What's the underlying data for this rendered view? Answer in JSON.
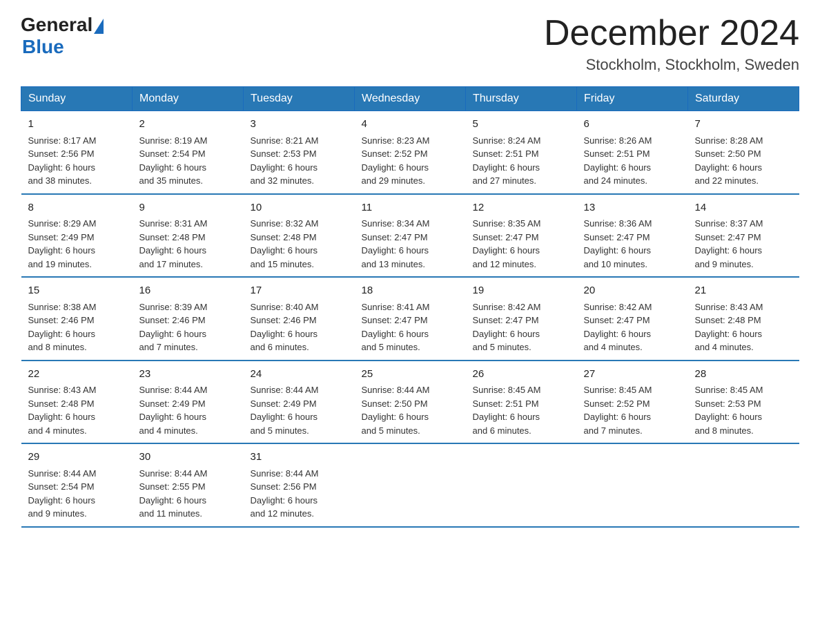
{
  "logo": {
    "general": "General",
    "blue": "Blue"
  },
  "header": {
    "month_year": "December 2024",
    "location": "Stockholm, Stockholm, Sweden"
  },
  "days_of_week": [
    "Sunday",
    "Monday",
    "Tuesday",
    "Wednesday",
    "Thursday",
    "Friday",
    "Saturday"
  ],
  "weeks": [
    [
      {
        "day": "1",
        "info": "Sunrise: 8:17 AM\nSunset: 2:56 PM\nDaylight: 6 hours\nand 38 minutes."
      },
      {
        "day": "2",
        "info": "Sunrise: 8:19 AM\nSunset: 2:54 PM\nDaylight: 6 hours\nand 35 minutes."
      },
      {
        "day": "3",
        "info": "Sunrise: 8:21 AM\nSunset: 2:53 PM\nDaylight: 6 hours\nand 32 minutes."
      },
      {
        "day": "4",
        "info": "Sunrise: 8:23 AM\nSunset: 2:52 PM\nDaylight: 6 hours\nand 29 minutes."
      },
      {
        "day": "5",
        "info": "Sunrise: 8:24 AM\nSunset: 2:51 PM\nDaylight: 6 hours\nand 27 minutes."
      },
      {
        "day": "6",
        "info": "Sunrise: 8:26 AM\nSunset: 2:51 PM\nDaylight: 6 hours\nand 24 minutes."
      },
      {
        "day": "7",
        "info": "Sunrise: 8:28 AM\nSunset: 2:50 PM\nDaylight: 6 hours\nand 22 minutes."
      }
    ],
    [
      {
        "day": "8",
        "info": "Sunrise: 8:29 AM\nSunset: 2:49 PM\nDaylight: 6 hours\nand 19 minutes."
      },
      {
        "day": "9",
        "info": "Sunrise: 8:31 AM\nSunset: 2:48 PM\nDaylight: 6 hours\nand 17 minutes."
      },
      {
        "day": "10",
        "info": "Sunrise: 8:32 AM\nSunset: 2:48 PM\nDaylight: 6 hours\nand 15 minutes."
      },
      {
        "day": "11",
        "info": "Sunrise: 8:34 AM\nSunset: 2:47 PM\nDaylight: 6 hours\nand 13 minutes."
      },
      {
        "day": "12",
        "info": "Sunrise: 8:35 AM\nSunset: 2:47 PM\nDaylight: 6 hours\nand 12 minutes."
      },
      {
        "day": "13",
        "info": "Sunrise: 8:36 AM\nSunset: 2:47 PM\nDaylight: 6 hours\nand 10 minutes."
      },
      {
        "day": "14",
        "info": "Sunrise: 8:37 AM\nSunset: 2:47 PM\nDaylight: 6 hours\nand 9 minutes."
      }
    ],
    [
      {
        "day": "15",
        "info": "Sunrise: 8:38 AM\nSunset: 2:46 PM\nDaylight: 6 hours\nand 8 minutes."
      },
      {
        "day": "16",
        "info": "Sunrise: 8:39 AM\nSunset: 2:46 PM\nDaylight: 6 hours\nand 7 minutes."
      },
      {
        "day": "17",
        "info": "Sunrise: 8:40 AM\nSunset: 2:46 PM\nDaylight: 6 hours\nand 6 minutes."
      },
      {
        "day": "18",
        "info": "Sunrise: 8:41 AM\nSunset: 2:47 PM\nDaylight: 6 hours\nand 5 minutes."
      },
      {
        "day": "19",
        "info": "Sunrise: 8:42 AM\nSunset: 2:47 PM\nDaylight: 6 hours\nand 5 minutes."
      },
      {
        "day": "20",
        "info": "Sunrise: 8:42 AM\nSunset: 2:47 PM\nDaylight: 6 hours\nand 4 minutes."
      },
      {
        "day": "21",
        "info": "Sunrise: 8:43 AM\nSunset: 2:48 PM\nDaylight: 6 hours\nand 4 minutes."
      }
    ],
    [
      {
        "day": "22",
        "info": "Sunrise: 8:43 AM\nSunset: 2:48 PM\nDaylight: 6 hours\nand 4 minutes."
      },
      {
        "day": "23",
        "info": "Sunrise: 8:44 AM\nSunset: 2:49 PM\nDaylight: 6 hours\nand 4 minutes."
      },
      {
        "day": "24",
        "info": "Sunrise: 8:44 AM\nSunset: 2:49 PM\nDaylight: 6 hours\nand 5 minutes."
      },
      {
        "day": "25",
        "info": "Sunrise: 8:44 AM\nSunset: 2:50 PM\nDaylight: 6 hours\nand 5 minutes."
      },
      {
        "day": "26",
        "info": "Sunrise: 8:45 AM\nSunset: 2:51 PM\nDaylight: 6 hours\nand 6 minutes."
      },
      {
        "day": "27",
        "info": "Sunrise: 8:45 AM\nSunset: 2:52 PM\nDaylight: 6 hours\nand 7 minutes."
      },
      {
        "day": "28",
        "info": "Sunrise: 8:45 AM\nSunset: 2:53 PM\nDaylight: 6 hours\nand 8 minutes."
      }
    ],
    [
      {
        "day": "29",
        "info": "Sunrise: 8:44 AM\nSunset: 2:54 PM\nDaylight: 6 hours\nand 9 minutes."
      },
      {
        "day": "30",
        "info": "Sunrise: 8:44 AM\nSunset: 2:55 PM\nDaylight: 6 hours\nand 11 minutes."
      },
      {
        "day": "31",
        "info": "Sunrise: 8:44 AM\nSunset: 2:56 PM\nDaylight: 6 hours\nand 12 minutes."
      },
      {
        "day": "",
        "info": ""
      },
      {
        "day": "",
        "info": ""
      },
      {
        "day": "",
        "info": ""
      },
      {
        "day": "",
        "info": ""
      }
    ]
  ]
}
